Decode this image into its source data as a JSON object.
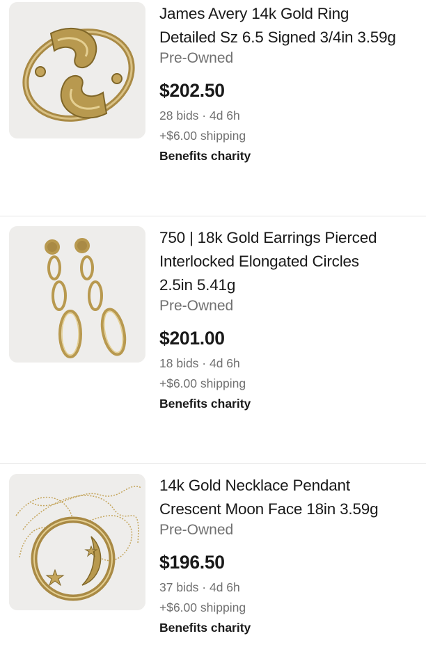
{
  "listings": [
    {
      "title_lines": [
        "James Avery 14k Gold Ring",
        "Detailed Sz 6.5 Signed 3/4in 3.59g"
      ],
      "condition": "Pre-Owned",
      "price": "$202.50",
      "bids_time": "28 bids · 4d 6h",
      "shipping": "+$6.00 shipping",
      "badge": "Benefits charity",
      "image": "gold-ring-photo"
    },
    {
      "title_lines": [
        "750 | 18k Gold Earrings Pierced",
        "Interlocked Elongated Circles",
        "2.5in 5.41g"
      ],
      "condition": "Pre-Owned",
      "price": "$201.00",
      "bids_time": "18 bids · 4d 6h",
      "shipping": "+$6.00 shipping",
      "badge": "Benefits charity",
      "image": "gold-earrings-photo"
    },
    {
      "title_lines": [
        "14k Gold Necklace Pendant",
        "Crescent Moon Face 18in 3.59g"
      ],
      "condition": "Pre-Owned",
      "price": "$196.50",
      "bids_time": "37 bids · 4d 6h",
      "shipping": "+$6.00 shipping",
      "badge": "Benefits charity",
      "image": "gold-necklace-photo"
    }
  ]
}
